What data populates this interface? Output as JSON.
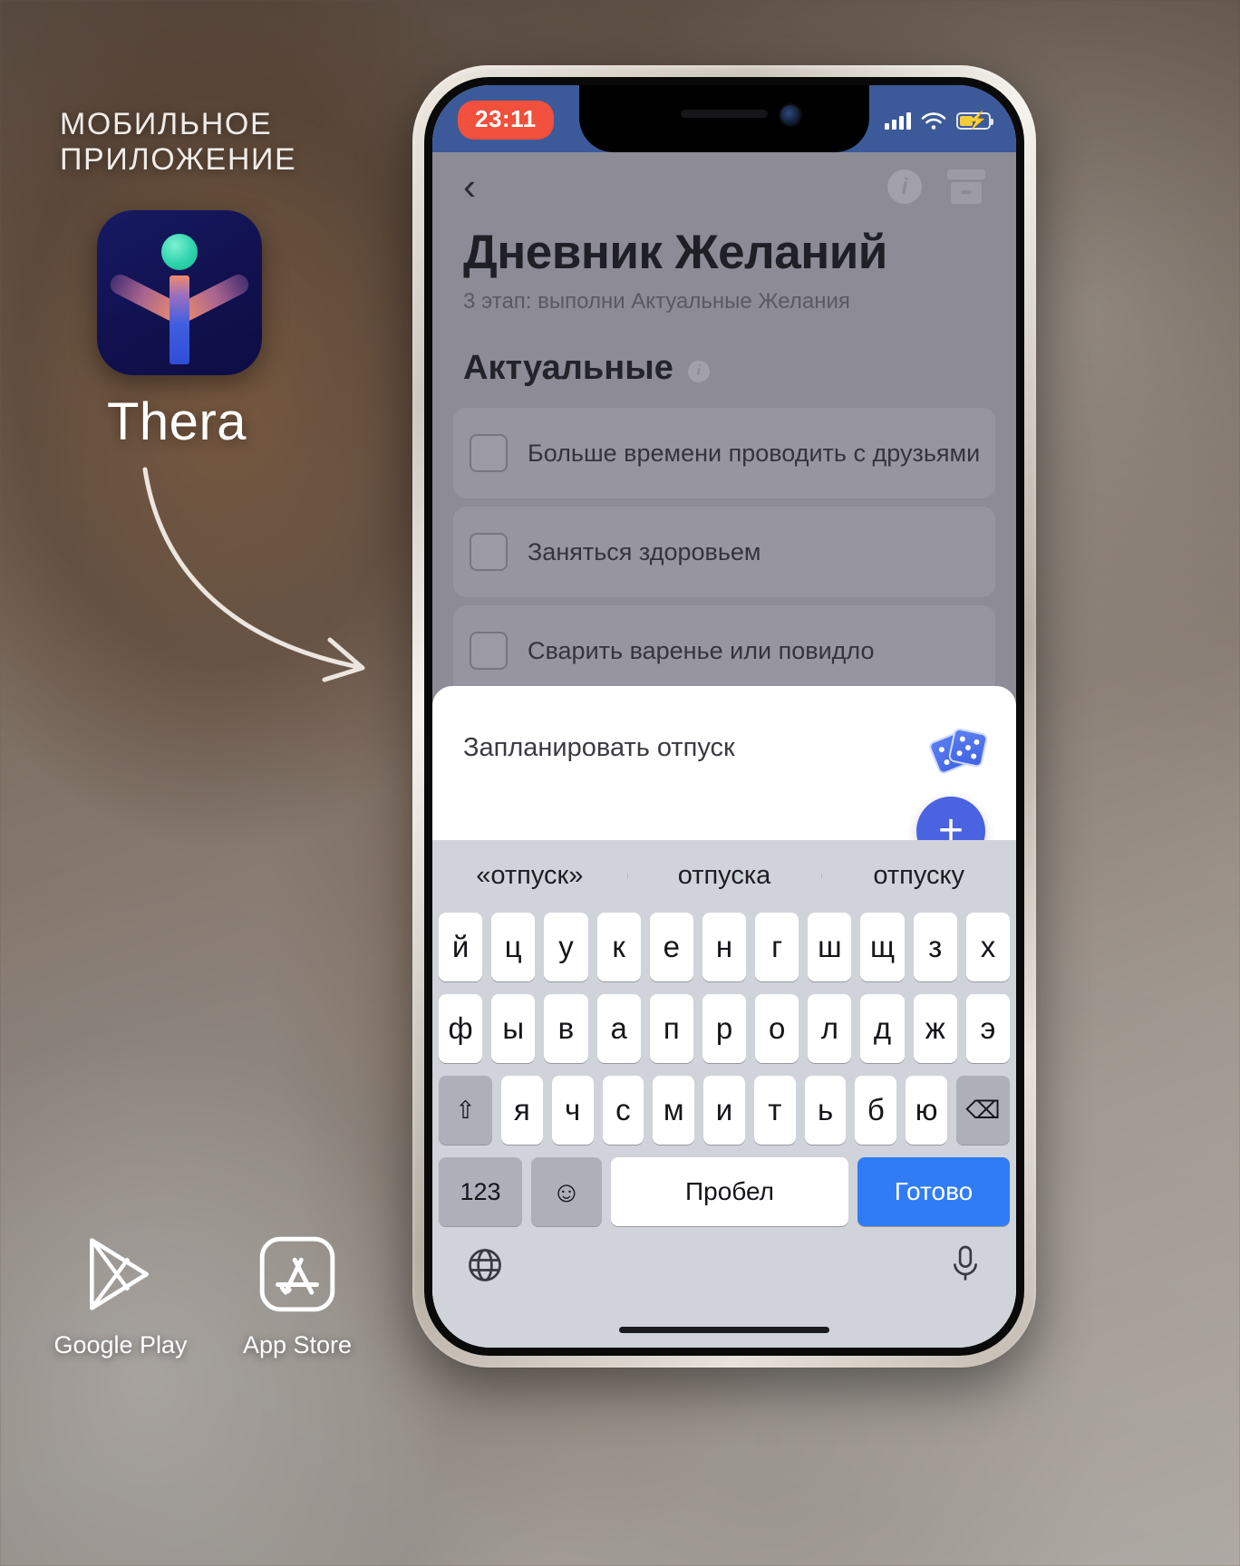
{
  "promo": {
    "kicker_line1": "МОБИЛЬНОЕ",
    "kicker_line2": "ПРИЛОЖЕНИЕ",
    "brand_name": "Thera",
    "app_icon_name": "thera-app-icon",
    "arrow_name": "curved-arrow",
    "stores": [
      {
        "label": "Google Play",
        "icon": "google-play-icon"
      },
      {
        "label": "App Store",
        "icon": "app-store-icon"
      }
    ]
  },
  "phone": {
    "statusbar": {
      "time": "23:11",
      "signal_icon": "cellular-signal-icon",
      "wifi_icon": "wifi-icon",
      "battery_icon": "battery-charging-icon",
      "battery_level_percent": 46
    },
    "navbar": {
      "back_icon": "chevron-left-icon",
      "back_glyph": "‹",
      "info_icon": "info-circle-icon",
      "info_glyph": "i",
      "archive_icon": "archive-box-icon"
    },
    "header": {
      "title": "Дневник Желаний",
      "subtitle": "3 этап: выполни Актуальные Желания"
    },
    "section": {
      "title": "Актуальные",
      "info_glyph": "i"
    },
    "wishes": [
      {
        "text": "Больше времени проводить с друзьями....",
        "checked": false
      },
      {
        "text": "Заняться здоровьем",
        "checked": false
      },
      {
        "text": "Сварить варенье или повидло",
        "checked": false
      }
    ],
    "sheet": {
      "input_value": "Запланировать отпуск",
      "input_placeholder": "Запланировать отпуск",
      "dice_icon": "dice-randomize-icon",
      "add_glyph": "+",
      "add_icon": "plus-icon"
    },
    "keyboard": {
      "suggestions": [
        "«отпуск»",
        "отпуска",
        "отпуску"
      ],
      "row1": [
        "й",
        "ц",
        "у",
        "к",
        "е",
        "н",
        "г",
        "ш",
        "щ",
        "з",
        "х"
      ],
      "row2": [
        "ф",
        "ы",
        "в",
        "а",
        "п",
        "р",
        "о",
        "л",
        "д",
        "ж",
        "э"
      ],
      "row3": [
        "я",
        "ч",
        "с",
        "м",
        "и",
        "т",
        "ь",
        "б",
        "ю"
      ],
      "shift_glyph": "⇧",
      "shift_icon": "shift-key-icon",
      "backspace_glyph": "⌫",
      "backspace_icon": "backspace-key-icon",
      "numbers_label": "123",
      "emoji_glyph": "☺",
      "emoji_icon": "emoji-key-icon",
      "space_label": "Пробел",
      "done_label": "Готово",
      "globe_icon": "globe-key-icon",
      "mic_icon": "microphone-key-icon"
    }
  },
  "colors": {
    "status_bar": "#3c5a99",
    "clock_pill": "#f0503c",
    "accent_blue": "#4a63e0",
    "keyboard_done": "#2f7cf6",
    "app_bg": "#8c8b96",
    "icon_navy": "#11114f"
  }
}
